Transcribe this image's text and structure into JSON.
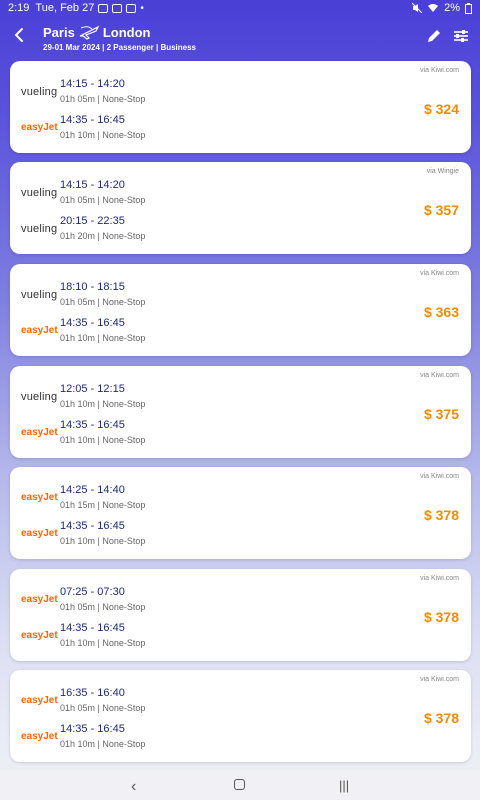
{
  "status": {
    "time": "2:19",
    "date": "Tue, Feb 27",
    "battery": "2%"
  },
  "header": {
    "from": "Paris",
    "to": "London",
    "subtitle": "29-01 Mar 2024 | 2 Passenger | Business"
  },
  "flights": [
    {
      "via": "via Kiwi.com",
      "price": "$ 324",
      "outbound": {
        "airline": "vueling",
        "times": "14:15 - 14:20",
        "details": "01h 05m | None-Stop"
      },
      "return": {
        "airline": "easyJet",
        "times": "14:35 - 16:45",
        "details": "01h 10m | None-Stop"
      }
    },
    {
      "via": "via Wingie",
      "price": "$ 357",
      "outbound": {
        "airline": "vueling",
        "times": "14:15 - 14:20",
        "details": "01h 05m | None-Stop"
      },
      "return": {
        "airline": "vueling",
        "times": "20:15 - 22:35",
        "details": "01h 20m | None-Stop"
      }
    },
    {
      "via": "via Kiwi.com",
      "price": "$ 363",
      "outbound": {
        "airline": "vueling",
        "times": "18:10 - 18:15",
        "details": "01h 05m | None-Stop"
      },
      "return": {
        "airline": "easyJet",
        "times": "14:35 - 16:45",
        "details": "01h 10m | None-Stop"
      }
    },
    {
      "via": "via Kiwi.com",
      "price": "$ 375",
      "outbound": {
        "airline": "vueling",
        "times": "12:05 - 12:15",
        "details": "01h 10m | None-Stop"
      },
      "return": {
        "airline": "easyJet",
        "times": "14:35 - 16:45",
        "details": "01h 10m | None-Stop"
      }
    },
    {
      "via": "via Kiwi.com",
      "price": "$ 378",
      "outbound": {
        "airline": "easyJet",
        "times": "14:25 - 14:40",
        "details": "01h 15m | None-Stop"
      },
      "return": {
        "airline": "easyJet",
        "times": "14:35 - 16:45",
        "details": "01h 10m | None-Stop"
      }
    },
    {
      "via": "via Kiwi.com",
      "price": "$ 378",
      "outbound": {
        "airline": "easyJet",
        "times": "07:25 - 07:30",
        "details": "01h 05m | None-Stop"
      },
      "return": {
        "airline": "easyJet",
        "times": "14:35 - 16:45",
        "details": "01h 10m | None-Stop"
      }
    },
    {
      "via": "via Kiwi.com",
      "price": "$ 378",
      "outbound": {
        "airline": "easyJet",
        "times": "16:35 - 16:40",
        "details": "01h 05m | None-Stop"
      },
      "return": {
        "airline": "easyJet",
        "times": "14:35 - 16:45",
        "details": "01h 10m | None-Stop"
      }
    }
  ]
}
